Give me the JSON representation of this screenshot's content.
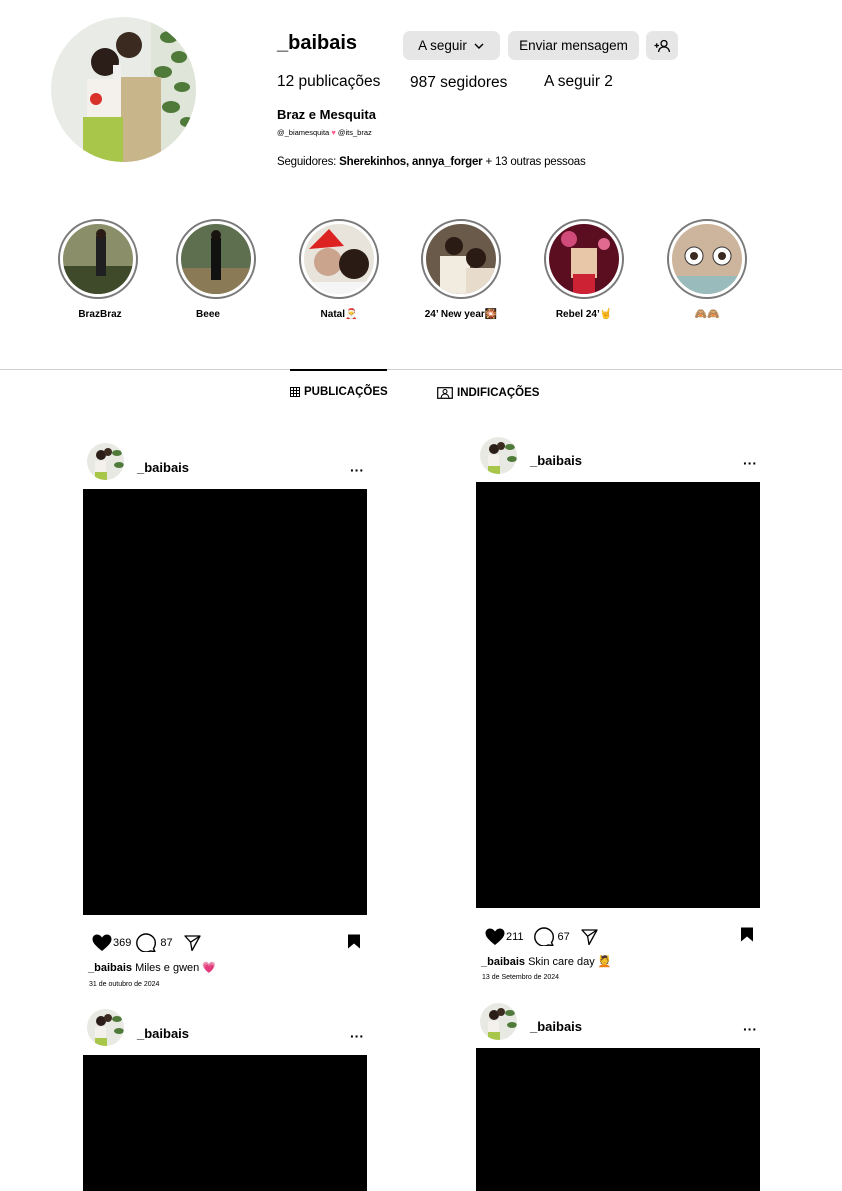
{
  "profile": {
    "username": "_baibais",
    "buttons": {
      "follow": "A seguir",
      "message": "Enviar mensagem"
    },
    "stats": {
      "posts": "12 publicações",
      "followers": "987 segidores",
      "following": "A seguir 2"
    },
    "full_name": "Braz e Mesquita",
    "bio_tags": {
      "first": "@_biamesquita",
      "second": "@its_braz"
    },
    "followed_by": {
      "prefix": "Seguidores: ",
      "names": "Sherekinhos, annya_forger",
      "suffix": " + 13 outras pessoas"
    }
  },
  "highlights": [
    {
      "label": "BrazBraz"
    },
    {
      "label": "Beee"
    },
    {
      "label": "Natal🎅"
    },
    {
      "label": "24’ New year🎇"
    },
    {
      "label": "Rebel 24’🤘"
    },
    {
      "label": "🙈🙈"
    }
  ],
  "tabs": {
    "posts": "PUBLICAÇÕES",
    "tagged": "INDIFICAÇÕES"
  },
  "posts": [
    {
      "username": "_baibais",
      "likes": "369",
      "comments": "87",
      "caption_user": "_baibais",
      "caption_text": " Miles e gwen 💗",
      "date": "31 de outubro de 2024"
    },
    {
      "username": "_baibais",
      "likes": "211",
      "comments": "67",
      "caption_user": "_baibais",
      "caption_text": " Skin care day 💆",
      "date": "13 de Setembro de 2024"
    },
    {
      "username": "_baibais"
    },
    {
      "username": "_baibais"
    }
  ],
  "colors": {
    "button_bg": "#e6e6e6",
    "heart": "#ff5a8a",
    "divider": "#cfcfcf"
  }
}
